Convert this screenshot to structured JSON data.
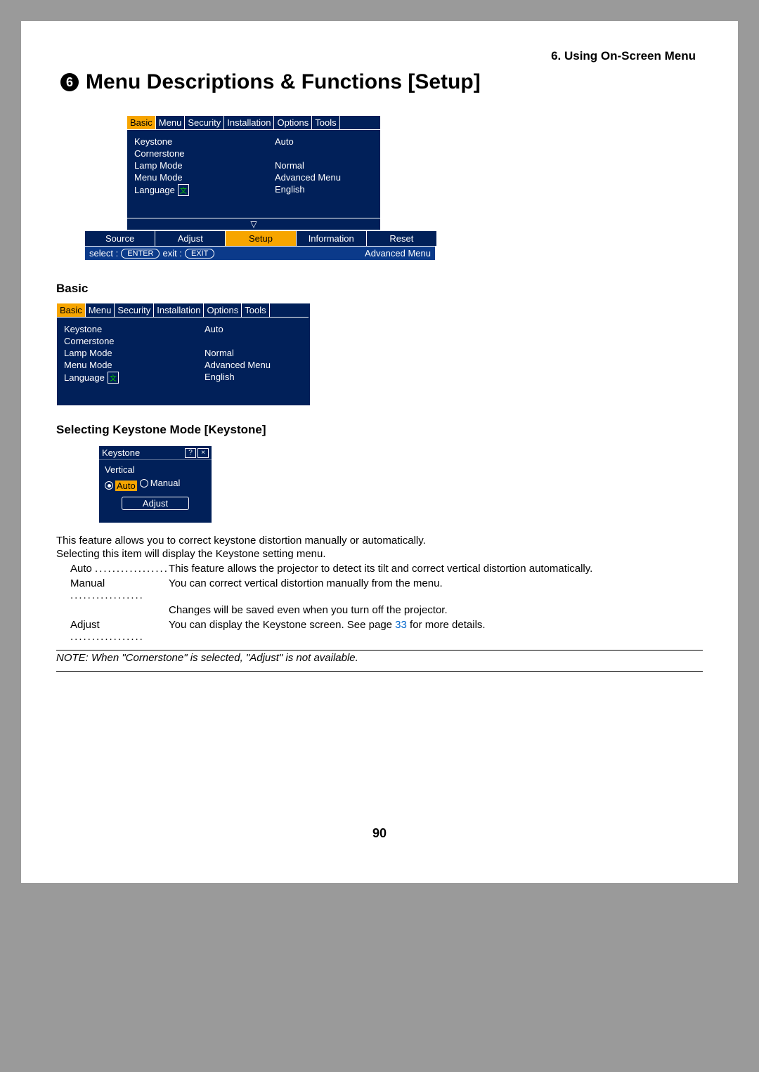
{
  "header": {
    "chapter": "6. Using On-Screen Menu"
  },
  "title": {
    "num": "6",
    "text": "Menu Descriptions & Functions [Setup]"
  },
  "tabs": {
    "items": [
      "Basic",
      "Menu",
      "Security",
      "Installation",
      "Options",
      "Tools"
    ],
    "active": "Basic"
  },
  "settings": [
    {
      "k": "Keystone",
      "v": "Auto"
    },
    {
      "k": "Cornerstone",
      "v": ""
    },
    {
      "k": "Lamp Mode",
      "v": "Normal"
    },
    {
      "k": "Menu Mode",
      "v": "Advanced Menu"
    },
    {
      "k": "Language",
      "v": "English",
      "icon": "文"
    }
  ],
  "tri": "▽",
  "main_tabs": {
    "items": [
      "Source",
      "Adjust",
      "Setup",
      "Information",
      "Reset"
    ],
    "active": "Setup"
  },
  "status": {
    "select_label": "select :",
    "select_key": "ENTER",
    "exit_label": "exit :",
    "exit_key": "EXIT",
    "mode": "Advanced Menu"
  },
  "sub_header": "Basic",
  "h3": "Selecting Keystone Mode [Keystone]",
  "keystone_dialog": {
    "title": "Keystone",
    "line1": "Vertical",
    "options": [
      {
        "label": "Auto",
        "selected": true
      },
      {
        "label": "Manual",
        "selected": false
      }
    ],
    "button": "Adjust"
  },
  "para1": "This feature allows you to correct keystone distortion manually or automatically.",
  "para2": "Selecting this item will display the Keystone setting menu.",
  "defs": [
    {
      "term": "Auto",
      "def": "This feature allows the projector to detect its tilt and correct vertical distortion automatically."
    },
    {
      "term": "Manual",
      "def": "You can correct vertical distortion manually from the menu."
    },
    {
      "cont": "Changes will be saved even when you turn off the projector."
    },
    {
      "term": "Adjust",
      "def_pre": "You can display the Keystone screen. See page ",
      "page": "33",
      "def_post": " for more details."
    }
  ],
  "note": "NOTE: When \"Cornerstone\" is selected, \"Adjust\" is not available.",
  "page_number": "90"
}
